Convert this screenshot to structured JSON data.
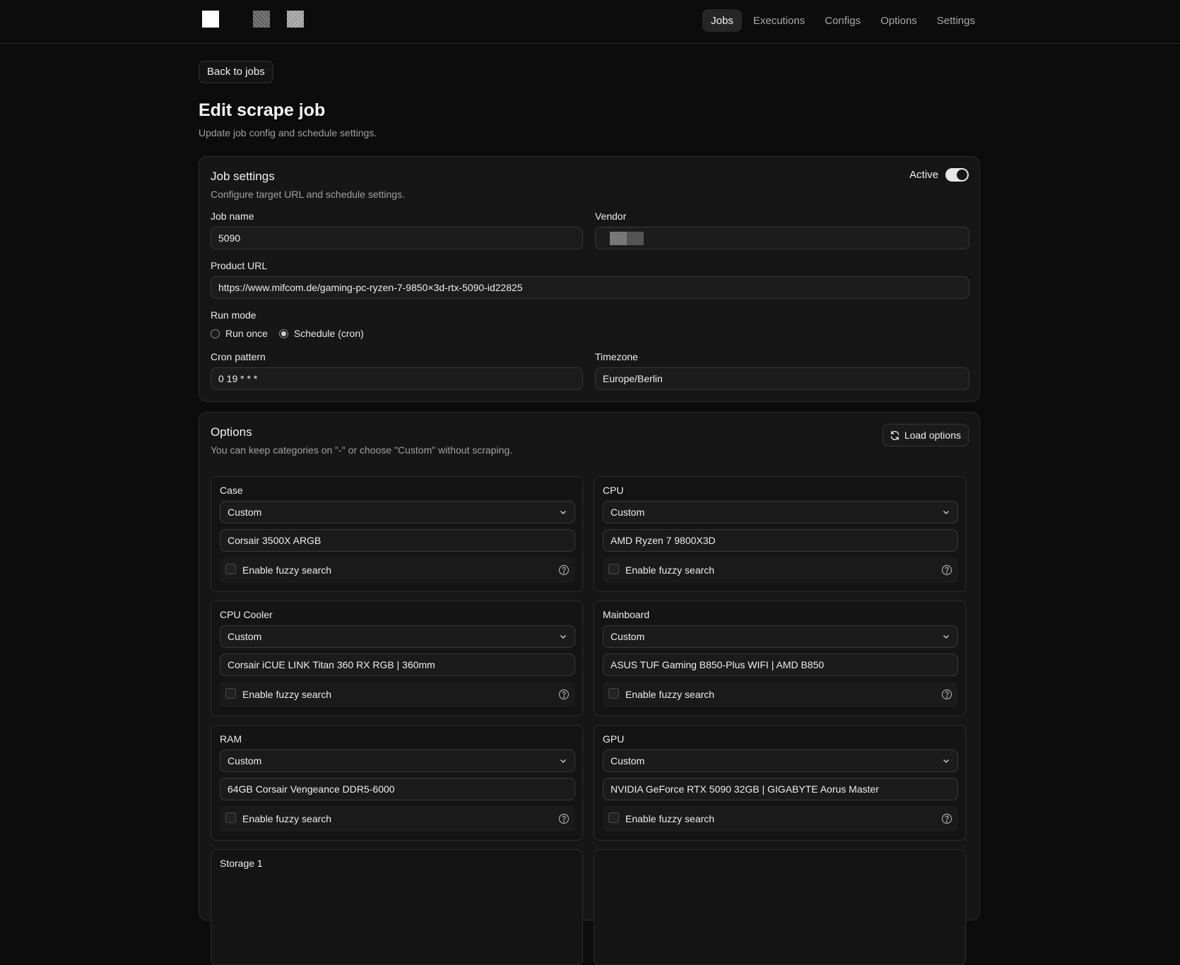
{
  "nav": {
    "items": [
      "Jobs",
      "Executions",
      "Configs",
      "Options",
      "Settings"
    ],
    "active": "Jobs"
  },
  "back_label": "Back to jobs",
  "page": {
    "title": "Edit scrape job",
    "subtitle": "Update job config and schedule settings."
  },
  "job_settings": {
    "title": "Job settings",
    "subtitle": "Configure target URL and schedule settings.",
    "active_label": "Active",
    "active": true,
    "job_name_label": "Job name",
    "job_name": "5090",
    "vendor_label": "Vendor",
    "product_url_label": "Product URL",
    "product_url": "https://www.mifcom.de/gaming-pc-ryzen-7-9850×3d-rtx-5090-id22825",
    "run_mode_label": "Run mode",
    "run_once_label": "Run once",
    "schedule_label": "Schedule (cron)",
    "selected_mode": "schedule",
    "cron_label": "Cron pattern",
    "cron": "0 19 * * *",
    "timezone_label": "Timezone",
    "timezone": "Europe/Berlin"
  },
  "options": {
    "title": "Options",
    "subtitle": "You can keep categories on \"-\" or choose \"Custom\" without scraping.",
    "load_label": "Load options",
    "fuzzy_label": "Enable fuzzy search",
    "categories": [
      {
        "name": "Case",
        "mode": "Custom",
        "value": "Corsair 3500X ARGB"
      },
      {
        "name": "CPU",
        "mode": "Custom",
        "value": "AMD Ryzen 7 9800X3D"
      },
      {
        "name": "CPU Cooler",
        "mode": "Custom",
        "value": "Corsair iCUE LINK Titan 360 RX RGB | 360mm"
      },
      {
        "name": "Mainboard",
        "mode": "Custom",
        "value": "ASUS TUF Gaming B850-Plus WIFI | AMD B850"
      },
      {
        "name": "RAM",
        "mode": "Custom",
        "value": "64GB Corsair Vengeance DDR5-6000"
      },
      {
        "name": "GPU",
        "mode": "Custom",
        "value": "NVIDIA GeForce RTX 5090 32GB | GIGABYTE Aorus Master"
      },
      {
        "name": "Storage 1",
        "mode": "",
        "value": ""
      },
      {
        "name": "",
        "mode": "",
        "value": ""
      }
    ]
  },
  "colors": {
    "background": "#0c0c0c",
    "card": "#161616",
    "border": "#2a2a2a",
    "text": "#ededed",
    "muted": "#a0a0a0"
  },
  "icons": [
    "refresh-icon",
    "chevron-down-icon",
    "help-circle-icon"
  ]
}
